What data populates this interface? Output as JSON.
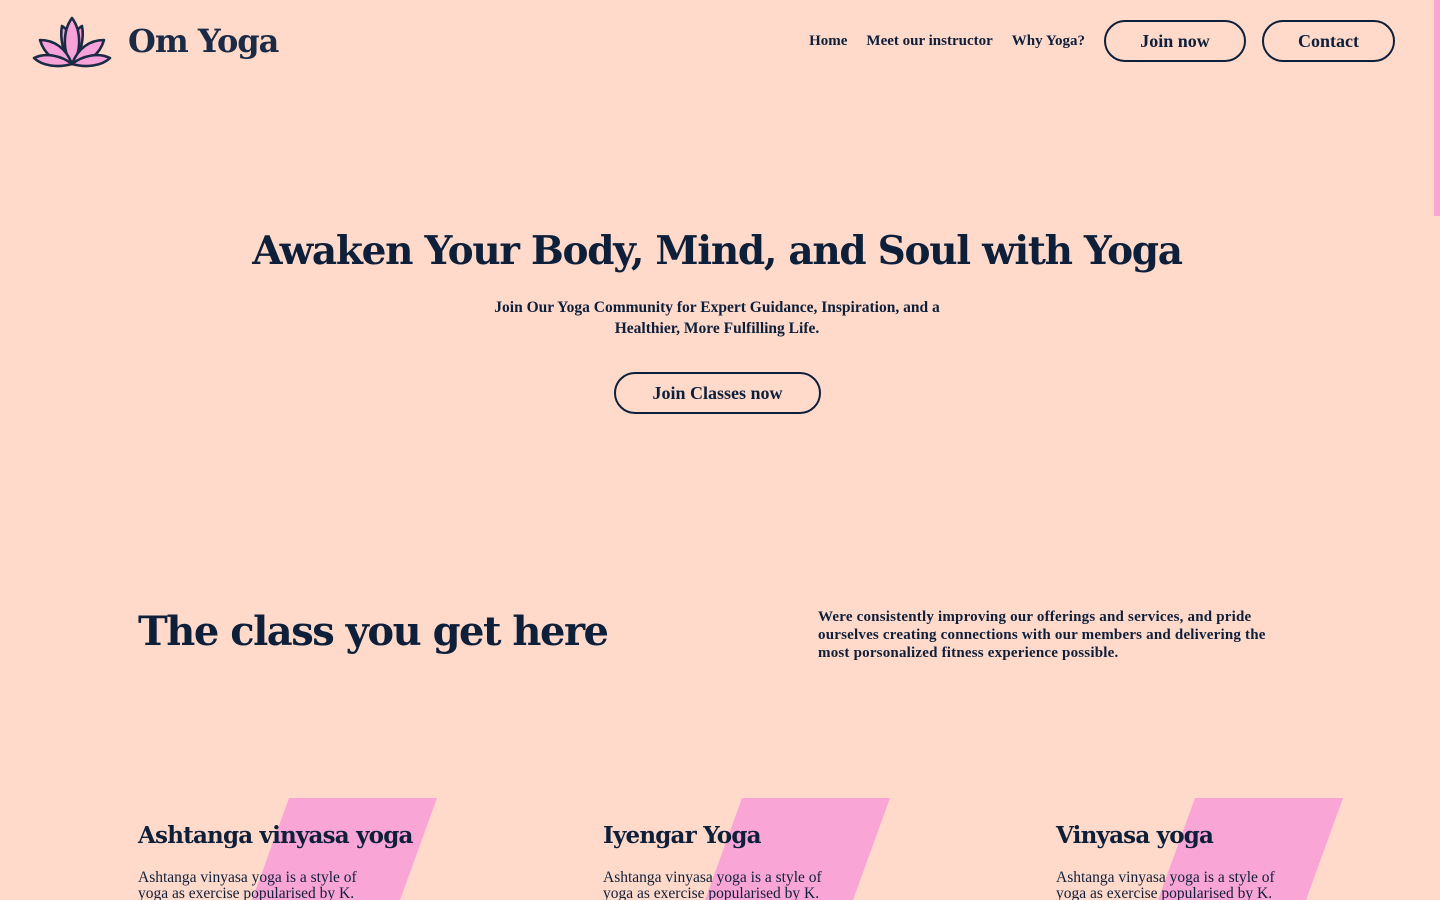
{
  "brand": {
    "name": "Om Yoga",
    "logo_icon": "lotus-icon",
    "colors": {
      "background": "#ffdacb",
      "text": "#0e1f3a",
      "accent_pink": "#f9a5d6"
    }
  },
  "nav": {
    "links": [
      "Home",
      "Meet our instructor",
      "Why Yoga?"
    ],
    "join_label": "Join now",
    "contact_label": "Contact"
  },
  "hero": {
    "title": "Awaken Your Body, Mind, and Soul with Yoga",
    "subtitle": "Join Our Yoga Community for Expert Guidance, Inspiration, and a Healthier, More Fulfilling Life.",
    "cta_label": "Join Classes now"
  },
  "classes": {
    "heading": "The class you get here",
    "description": "Were consistently improving our offerings and services, and pride ourselves creating connections with our members and delivering the most porsonalized fitness experience possible.",
    "cards": [
      {
        "title": "Ashtanga vinyasa yoga",
        "text": "Ashtanga vinyasa yoga is a style of yoga as exercise popularised by K."
      },
      {
        "title": "Iyengar Yoga",
        "text": "Ashtanga vinyasa yoga is a style of yoga as exercise popularised by K."
      },
      {
        "title": "Vinyasa yoga",
        "text": "Ashtanga vinyasa yoga is a style of yoga as exercise popularised by K."
      }
    ]
  }
}
